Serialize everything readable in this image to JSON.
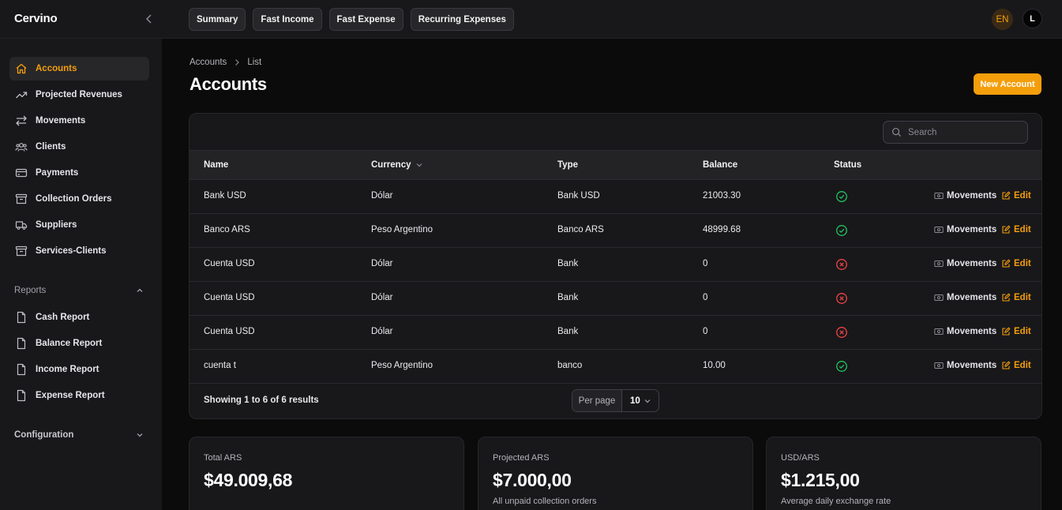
{
  "app": {
    "brand": "Cervino"
  },
  "topbar": {
    "quick_actions": [
      "Summary",
      "Fast Income",
      "Fast Expense",
      "Recurring Expenses"
    ],
    "language": "EN",
    "user_initial": "L"
  },
  "sidebar": {
    "items": [
      {
        "label": "Accounts",
        "icon": "home-icon",
        "active": true
      },
      {
        "label": "Projected Revenues",
        "icon": "trending-up-icon"
      },
      {
        "label": "Movements",
        "icon": "arrows-left-right-icon"
      },
      {
        "label": "Clients",
        "icon": "users-icon"
      },
      {
        "label": "Payments",
        "icon": "credit-card-icon"
      },
      {
        "label": "Collection Orders",
        "icon": "archive-box-icon"
      },
      {
        "label": "Suppliers",
        "icon": "truck-icon"
      },
      {
        "label": "Services-Clients",
        "icon": "archive-box-icon"
      }
    ],
    "reports_group": {
      "label": "Reports",
      "expanded": true,
      "items": [
        {
          "label": "Cash Report",
          "icon": "document-icon"
        },
        {
          "label": "Balance Report",
          "icon": "document-icon"
        },
        {
          "label": "Income Report",
          "icon": "document-icon"
        },
        {
          "label": "Expense Report",
          "icon": "document-icon"
        }
      ]
    },
    "configuration_group": {
      "label": "Configuration",
      "expanded": false
    }
  },
  "main": {
    "breadcrumb": [
      "Accounts",
      "List"
    ],
    "title": "Accounts",
    "new_button": "New Account",
    "search": {
      "placeholder": "Search",
      "value": ""
    },
    "table": {
      "columns": [
        "Name",
        "Currency",
        "Type",
        "Balance",
        "Status"
      ],
      "rows": [
        {
          "name": "Bank USD",
          "currency": "Dólar",
          "type": "Bank USD",
          "balance": "21003.30",
          "status": "active"
        },
        {
          "name": "Banco ARS",
          "currency": "Peso Argentino",
          "type": "Banco ARS",
          "balance": "48999.68",
          "status": "active"
        },
        {
          "name": "Cuenta USD",
          "currency": "Dólar",
          "type": "Bank",
          "balance": "0",
          "status": "inactive"
        },
        {
          "name": "Cuenta USD",
          "currency": "Dólar",
          "type": "Bank",
          "balance": "0",
          "status": "inactive"
        },
        {
          "name": "Cuenta USD",
          "currency": "Dólar",
          "type": "Bank",
          "balance": "0",
          "status": "inactive"
        },
        {
          "name": "cuenta t",
          "currency": "Peso Argentino",
          "type": "banco",
          "balance": "10.00",
          "status": "active"
        }
      ],
      "row_actions": {
        "movements": "Movements",
        "edit": "Edit"
      },
      "footer": {
        "showing": "Showing 1 to 6 of 6 results",
        "per_page_label": "Per page",
        "per_page_value": "10"
      }
    },
    "stats": [
      {
        "label": "Total ARS",
        "value": "$49.009,68",
        "description": ""
      },
      {
        "label": "Projected ARS",
        "value": "$7.000,00",
        "description": "All unpaid collection orders"
      },
      {
        "label": "USD/ARS",
        "value": "$1.215,00",
        "description": "Average daily exchange rate"
      }
    ]
  },
  "colors": {
    "accent": "#f59e0b",
    "background": "#0b0b0c",
    "panel": "#18181b",
    "success": "#22c55e",
    "danger": "#ef4444"
  }
}
